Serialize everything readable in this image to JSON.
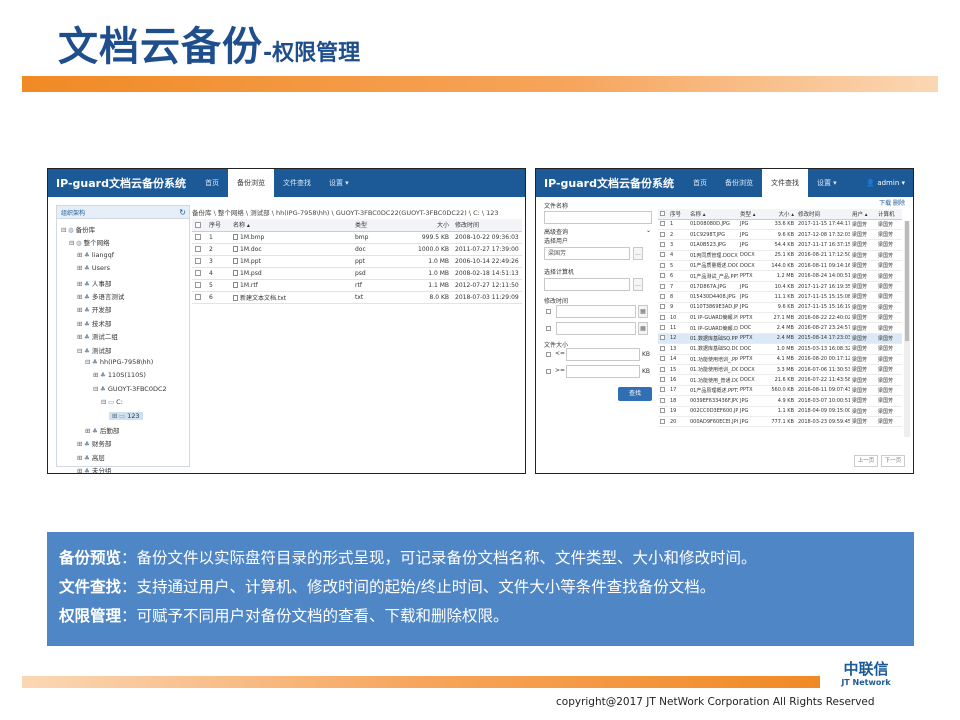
{
  "slide": {
    "title_main": "文档云备份",
    "title_sub": "-权限管理",
    "copyright": "copyright@2017  JT NetWork Corporation All Rights Reserved",
    "logo_cn": "中联信",
    "logo_en": "JT Network"
  },
  "colors": {
    "accent_orange": "#f08a24",
    "brand_blue": "#1c5a97",
    "desc_bg": "#4f86c6"
  },
  "left_app": {
    "brand": "IP-guard文档云备份系统",
    "tabs": [
      "首页",
      "备份浏览",
      "文件查找",
      "设置 ▾"
    ],
    "active_tab": "备份浏览",
    "tree_header": "组织架构",
    "tree": [
      {
        "label": "备份库",
        "level": 0,
        "toggle": "⊟"
      },
      {
        "label": "整个网络",
        "level": 1,
        "toggle": "⊟"
      },
      {
        "label": "liangqf",
        "level": 2,
        "toggle": "⊞"
      },
      {
        "label": "Users",
        "level": 2,
        "toggle": "⊞"
      },
      {
        "label": "人事部",
        "level": 2,
        "toggle": "⊞"
      },
      {
        "label": "多语言测试",
        "level": 2,
        "toggle": "⊞"
      },
      {
        "label": "开发部",
        "level": 2,
        "toggle": "⊞"
      },
      {
        "label": "技术部",
        "level": 2,
        "toggle": "⊞"
      },
      {
        "label": "测试二组",
        "level": 2,
        "toggle": "⊞"
      },
      {
        "label": "测试部",
        "level": 2,
        "toggle": "⊟"
      },
      {
        "label": "hh(IPG-7958\\hh)",
        "level": 3,
        "toggle": "⊟"
      },
      {
        "label": "110S(110S)",
        "level": 4,
        "toggle": "⊞"
      },
      {
        "label": "GUOYT-3FBC0DC2",
        "level": 4,
        "toggle": "⊟"
      },
      {
        "label": "C:",
        "level": 5,
        "toggle": "⊟"
      },
      {
        "label": "123",
        "level": 6,
        "toggle": "⊞"
      },
      {
        "label": "后勤部",
        "level": 3,
        "toggle": "⊞"
      },
      {
        "label": "财务部",
        "level": 2,
        "toggle": "⊞"
      },
      {
        "label": "高层",
        "level": 2,
        "toggle": "⊞"
      },
      {
        "label": "未分组",
        "level": 2,
        "toggle": "⊞"
      }
    ],
    "path": "备份库 \\ 整个网络 \\ 测试部 \\ hh(IPG-7958\\hh) \\ GUOYT-3FBC0DC22(GUOYT-3FBC0DC22) \\ C: \\ 123",
    "columns": [
      "序号",
      "名称 ▴",
      "类型",
      "大小",
      "修改时间"
    ],
    "rows": [
      [
        "1",
        "1M.bmp",
        "bmp",
        "999.5 KB",
        "2008-10-22 09:36:03"
      ],
      [
        "2",
        "1M.doc",
        "doc",
        "1000.0 KB",
        "2011-07-27 17:39:00"
      ],
      [
        "3",
        "1M.ppt",
        "ppt",
        "1.0 MB",
        "2006-10-14 22:49:26"
      ],
      [
        "4",
        "1M.psd",
        "psd",
        "1.0 MB",
        "2008-02-18 14:51:13"
      ],
      [
        "5",
        "1M.rtf",
        "rtf",
        "1.1 MB",
        "2012-07-27 12:11:50"
      ],
      [
        "6",
        "新建文本文档.txt",
        "txt",
        "8.0 KB",
        "2018-07-03 11:29:09"
      ]
    ]
  },
  "right_app": {
    "brand": "IP-guard文档云备份系统",
    "tabs": [
      "首页",
      "备份浏览",
      "文件查找",
      "设置 ▾"
    ],
    "active_tab": "文件查找",
    "user": "admin ▾",
    "search": {
      "file_name_label": "文件名称",
      "advanced_label": "高级查询",
      "user_label": "选择用户",
      "user_value": "梁国芳",
      "computer_label": "选择计算机",
      "mtime_label": "修改时间",
      "size_label": "文件大小",
      "lt": "<=",
      "gt": ">=",
      "kb": "KB",
      "search_button": "查找",
      "more_button": "...",
      "chevron": "⌄"
    },
    "actions": "下载  删除",
    "columns": [
      "序号",
      "名称 ▴",
      "类型 ▴",
      "大小 ▴",
      "修改时间",
      "用户 ▴",
      "计算机"
    ],
    "rows": [
      [
        "1",
        "01D08080D.JPG",
        "JPG",
        "33.6 KB",
        "2017-11-15 17:44:17",
        "梁国芳",
        "梁国芳"
      ],
      [
        "2",
        "01C9298T.JPG",
        "JPG",
        "9.6 KB",
        "2017-12-08 17:32:03",
        "梁国芳",
        "梁国芳"
      ],
      [
        "3",
        "01A0B523.JPG",
        "JPG",
        "54.4 KB",
        "2017-11-17 16:37:15",
        "梁国芳",
        "梁国芳"
      ],
      [
        "4",
        "01丙同质管理.DOCX",
        "DOCX",
        "25.1 KB",
        "2016-08-21 17:12:50",
        "梁国芳",
        "梁国芳"
      ],
      [
        "5",
        "01产品质量概述.DOCX",
        "DOCX",
        "144.0 KB",
        "2016-08-11 09:14:16",
        "梁国芳",
        "梁国芳"
      ],
      [
        "6",
        "01产品测试_产品.PPTX",
        "PPTX",
        "1.2 MB",
        "2016-08-24 14:00:51",
        "梁国芳",
        "梁国芳"
      ],
      [
        "7",
        "017D867A.JPG",
        "JPG",
        "10.4 KB",
        "2017-11-27 16:19:35",
        "梁国芳",
        "梁国芳"
      ],
      [
        "8",
        "015430D4408.JPG",
        "JPG",
        "11.1 KB",
        "2017-11-15 15:15:08",
        "梁国芳",
        "梁国芳"
      ],
      [
        "9",
        "0110T3869E3AD.JPG",
        "JPG",
        "9.6 KB",
        "2017-11-15 15:16:19",
        "梁国芳",
        "梁国芳"
      ],
      [
        "10",
        "01 IP-GUARD簡報.PPTX",
        "PPTX",
        "27.1 MB",
        "2016-08-22 22:40:02",
        "梁国芳",
        "梁国芳"
      ],
      [
        "11",
        "01 IP-GUARD簡報.DOC",
        "DOC",
        "2.4 MB",
        "2016-08-27 23:24:57",
        "梁国芳",
        "梁国芳"
      ],
      [
        "12",
        "01.数据库基础SQ.PPTX",
        "PPTX",
        "2.4 MB",
        "2015-08-14 17:23:03",
        "梁国芳",
        "梁国芳"
      ],
      [
        "13",
        "01.数据库基础SQ.DOC",
        "DOC",
        "1.0 MB",
        "2015-03-13 16:08:32",
        "梁国芳",
        "梁国芳"
      ],
      [
        "14",
        "01.功能使用培训_.PPTX",
        "PPTX",
        "4.1 MB",
        "2016-08-20 00:17:12",
        "梁国芳",
        "梁国芳"
      ],
      [
        "15",
        "01.功能使用培训_.DOCX",
        "DOCX",
        "3.3 MB",
        "2016-07-06 11:30:53",
        "梁国芳",
        "梁国芳"
      ],
      [
        "16",
        "01.功能使用_普通.DOCX",
        "DOCX",
        "21.6 KB",
        "2016-07-22 11:43:58",
        "梁国芳",
        "梁国芳"
      ],
      [
        "17",
        "01产品原理概述.PPTX",
        "PPTX",
        "560.0 KB",
        "2016-08-11 09:07:43",
        "梁国芳",
        "梁国芳"
      ],
      [
        "18",
        "0039EF633436F.JPG",
        "JPG",
        "4.9 KB",
        "2018-03-07 10:00:51",
        "梁国芳",
        "梁国芳"
      ],
      [
        "19",
        "002CC0D3EF600.JPG",
        "JPG",
        "1.1 KB",
        "2018-04-09 09:15:00",
        "梁国芳",
        "梁国芳"
      ],
      [
        "20",
        "000AD9F60ECEI.JPG",
        "JPG",
        "777.1 KB",
        "2018-03-23 09:59:45",
        "梁国芳",
        "梁国芳"
      ]
    ],
    "highlighted_row": 12,
    "pager_prev": "上一页",
    "pager_next": "下一页"
  },
  "description": [
    {
      "term": "备份预览",
      "text": "：备份文件以实际盘符目录的形式呈现，可记录备份文档名称、文件类型、大小和修改时间。"
    },
    {
      "term": "文件查找",
      "text": "：支持通过用户、计算机、修改时间的起始/终止时间、文件大小等条件查找备份文档。"
    },
    {
      "term": "权限管理",
      "text": "：可赋予不同用户对备份文档的查看、下载和删除权限。"
    }
  ]
}
